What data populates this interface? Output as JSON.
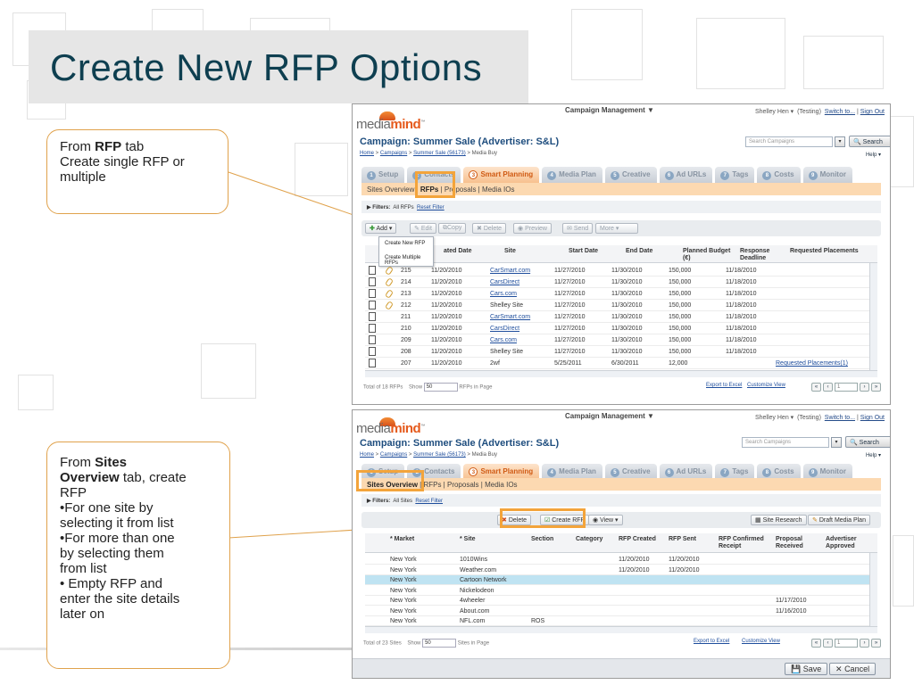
{
  "slide": {
    "title": "Create New RFP Options"
  },
  "callout_rfp": {
    "line1_prefix": "From ",
    "line1_bold": "RFP",
    "line1_suffix": " tab",
    "line2": "Create single RFP or",
    "line3": "multiple"
  },
  "callout_sites": {
    "line1_prefix": "From ",
    "line1_bold": "Sites",
    "line2_bold": "Overview",
    "line2_suffix": " tab, create",
    "line3": "RFP",
    "bullets": [
      "•For one site by",
      "selecting it from list",
      "•For more than one",
      "by selecting them",
      "from list",
      "• Empty RFP and",
      "enter the site details",
      "later on"
    ]
  },
  "app_common": {
    "logo_main": "media",
    "logo_accent": "mind",
    "logo_tm": "™",
    "campaign_mgmt": "Campaign Management",
    "caret": "▼",
    "user_name": "Shelley Hen ▾",
    "user_mode": "(Testing)",
    "switch_to": "Switch to...",
    "sign_out": "Sign Out",
    "campaign_title": "Campaign: Summer Sale (Advertiser: S&L)",
    "crumb_home": "Home",
    "crumb_sep": " > ",
    "crumb_campaigns": "Campaigns",
    "crumb_sale": "Summer Sale (56173)",
    "crumb_current": "Media Buy",
    "search_placeholder": "Search Campaigns",
    "search_button": "Search",
    "help": "Help ▾",
    "tabs": [
      {
        "num": "1",
        "label": "Setup"
      },
      {
        "num": "2",
        "label": "Contacts"
      },
      {
        "num": "3",
        "label": "Smart Planning"
      },
      {
        "num": "4",
        "label": "Media Plan"
      },
      {
        "num": "5",
        "label": "Creative"
      },
      {
        "num": "6",
        "label": "Ad URLs"
      },
      {
        "num": "7",
        "label": "Tags"
      },
      {
        "num": "8",
        "label": "Costs"
      },
      {
        "num": "9",
        "label": "Monitor"
      }
    ],
    "subnav": [
      "Sites Overview",
      "RFPs",
      "Proposals",
      "Media IOs"
    ],
    "subnav_sep": " | ",
    "export": "Export to Excel",
    "customize": "Customize View",
    "show_label": "Show",
    "show_value": "50",
    "pager_first": "«",
    "pager_prev": "‹",
    "pager_page": "1",
    "pager_next": "›",
    "pager_last": "»"
  },
  "rfps_screen": {
    "filters_label": "▶ Filters:",
    "filters_value": "All RFPs",
    "reset_filter": "Reset Filter",
    "toolbar": [
      "Add ▾",
      "Edit",
      "Copy",
      "Delete",
      "Preview",
      "Send",
      "More ▾"
    ],
    "add_menu": [
      "Create New RFP",
      "Create Multiple RFPs"
    ],
    "columns": [
      "ated Date",
      "Site",
      "Start Date",
      "End Date",
      "Planned Budget (€)",
      "Response Deadline",
      "Requested Placements"
    ],
    "rows": [
      {
        "id": "215",
        "created": "11/20/2010",
        "site": "CarSmart.com",
        "site_link": true,
        "start": "11/27/2010",
        "end": "11/30/2010",
        "budget": "150,000",
        "deadline": "11/18/2010",
        "placements": "",
        "clip": true
      },
      {
        "id": "214",
        "created": "11/20/2010",
        "site": "CarsDirect",
        "site_link": true,
        "start": "11/27/2010",
        "end": "11/30/2010",
        "budget": "150,000",
        "deadline": "11/18/2010",
        "placements": "",
        "clip": true
      },
      {
        "id": "213",
        "created": "11/20/2010",
        "site": "Cars.com",
        "site_link": true,
        "start": "11/27/2010",
        "end": "11/30/2010",
        "budget": "150,000",
        "deadline": "11/18/2010",
        "placements": "",
        "clip": true
      },
      {
        "id": "212",
        "created": "11/20/2010",
        "site": "Shelley Site",
        "site_link": false,
        "start": "11/27/2010",
        "end": "11/30/2010",
        "budget": "150,000",
        "deadline": "11/18/2010",
        "placements": "",
        "clip": true
      },
      {
        "id": "211",
        "created": "11/20/2010",
        "site": "CarSmart.com",
        "site_link": true,
        "start": "11/27/2010",
        "end": "11/30/2010",
        "budget": "150,000",
        "deadline": "11/18/2010",
        "placements": "",
        "clip": false
      },
      {
        "id": "210",
        "created": "11/20/2010",
        "site": "CarsDirect",
        "site_link": true,
        "start": "11/27/2010",
        "end": "11/30/2010",
        "budget": "150,000",
        "deadline": "11/18/2010",
        "placements": "",
        "clip": false
      },
      {
        "id": "209",
        "created": "11/20/2010",
        "site": "Cars.com",
        "site_link": true,
        "start": "11/27/2010",
        "end": "11/30/2010",
        "budget": "150,000",
        "deadline": "11/18/2010",
        "placements": "",
        "clip": false
      },
      {
        "id": "208",
        "created": "11/20/2010",
        "site": "Shelley Site",
        "site_link": false,
        "start": "11/27/2010",
        "end": "11/30/2010",
        "budget": "150,000",
        "deadline": "11/18/2010",
        "placements": "",
        "clip": false
      },
      {
        "id": "207",
        "created": "11/20/2010",
        "site": "2wf",
        "site_link": false,
        "start": "5/25/2011",
        "end": "6/30/2011",
        "budget": "12,000",
        "deadline": "",
        "placements": "Requested Placements(1)",
        "clip": false
      }
    ],
    "total": "Total of 18 RFPs",
    "per_page": "RFPs in Page"
  },
  "sites_screen": {
    "filters_label": "▶ Filters:",
    "filters_value": "All Sites",
    "reset_filter": "Reset Filter",
    "toolbar": [
      "Delete",
      "Create RFP",
      "View ▾"
    ],
    "toolbar_right": [
      "Site Research",
      "Draft Media Plan"
    ],
    "columns": [
      "* Market",
      "* Site",
      "Section",
      "Category",
      "RFP Created",
      "RFP Sent",
      "RFP Confirmed Receipt",
      "Proposal Received",
      "Advertiser Approved"
    ],
    "rows": [
      {
        "market": "New York",
        "site": "1010Wins",
        "section": "",
        "created": "11/20/2010",
        "sent": "11/20/2010",
        "proposal": "",
        "hl": false
      },
      {
        "market": "New York",
        "site": "Weather.com",
        "section": "",
        "created": "11/20/2010",
        "sent": "11/20/2010",
        "proposal": "",
        "hl": false
      },
      {
        "market": "New York",
        "site": "Cartoon Network",
        "section": "",
        "created": "",
        "sent": "",
        "proposal": "",
        "hl": true
      },
      {
        "market": "New York",
        "site": "Nickelodeon",
        "section": "",
        "created": "",
        "sent": "",
        "proposal": "",
        "hl": false
      },
      {
        "market": "New York",
        "site": "4wheeler",
        "section": "",
        "created": "",
        "sent": "",
        "proposal": "11/17/2010",
        "hl": false
      },
      {
        "market": "New York",
        "site": "About.com",
        "section": "",
        "created": "",
        "sent": "",
        "proposal": "11/16/2010",
        "hl": false
      },
      {
        "market": "New York",
        "site": "NFL.com",
        "section": "ROS",
        "created": "",
        "sent": "",
        "proposal": "",
        "hl": false
      }
    ],
    "total": "Total of 23 Sites",
    "per_page": "Sites in Page",
    "save": "Save",
    "cancel": "Cancel"
  },
  "colors": {
    "title": "#0e3f50",
    "callout_border": "#e0a24c",
    "highlight": "#f3a43b",
    "subnav_bg": "#fcd9b1",
    "selected_row": "#bfe3f2"
  }
}
